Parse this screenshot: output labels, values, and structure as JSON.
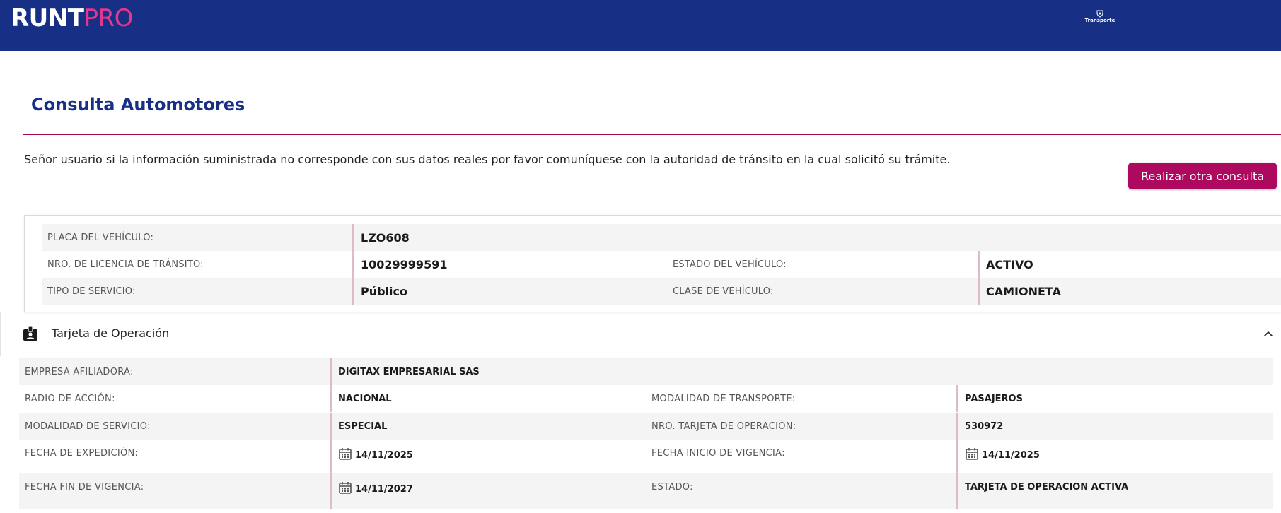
{
  "header": {
    "logo_bold": "RUNT",
    "logo_light": "PRO",
    "gov_logo_text": "Transporte",
    "bg_color": "#172f84",
    "accent_color": "#e0378f"
  },
  "page": {
    "title": "Consulta Automotores",
    "notice": "Señor usuario si la información suministrada no corresponde con sus datos reales por favor comuníquese con la autoridad de tránsito en la cual solicitó su trámite.",
    "new_query_button": "Realizar otra consulta",
    "button_color": "#ad0a5f"
  },
  "vehicle": {
    "placa_label": "PLACA DEL VEHÍCULO:",
    "placa_value": "LZO608",
    "licencia_label": "NRO. DE LICENCIA DE TRÁNSITO:",
    "licencia_value": "10029999591",
    "estado_label": "ESTADO DEL VEHÍCULO:",
    "estado_value": "ACTIVO",
    "servicio_label": "TIPO DE SERVICIO:",
    "servicio_value": "Público",
    "clase_label": "CLASE DE VEHÍCULO:",
    "clase_value": "CAMIONETA"
  },
  "operation": {
    "section_title": "Tarjeta de Operación",
    "section_icon": "id-badge-icon",
    "collapse_icon": "chevron-up-icon",
    "empresa_label": "EMPRESA AFILIADORA:",
    "empresa_value": "DIGITAX EMPRESARIAL SAS",
    "radio_label": "RADIO DE ACCIÓN:",
    "radio_value": "NACIONAL",
    "modalidad_transporte_label": "MODALIDAD DE TRANSPORTE:",
    "modalidad_transporte_value": "PASAJEROS",
    "modalidad_servicio_label": "MODALIDAD DE SERVICIO:",
    "modalidad_servicio_value": "ESPECIAL",
    "nro_tarjeta_label": "NRO. TARJETA DE OPERACIÓN:",
    "nro_tarjeta_value": "530972",
    "fecha_expedicion_label": "FECHA DE EXPEDICIÓN:",
    "fecha_expedicion_value": "14/11/2025",
    "fecha_inicio_label": "FECHA INICIO DE VIGENCIA:",
    "fecha_inicio_value": "14/11/2025",
    "fecha_fin_label": "FECHA FIN DE VIGENCIA:",
    "fecha_fin_value": "14/11/2027",
    "estado_label": "ESTADO:",
    "estado_value": "TARJETA DE OPERACION ACTIVA",
    "date_icon": "calendar-icon"
  }
}
